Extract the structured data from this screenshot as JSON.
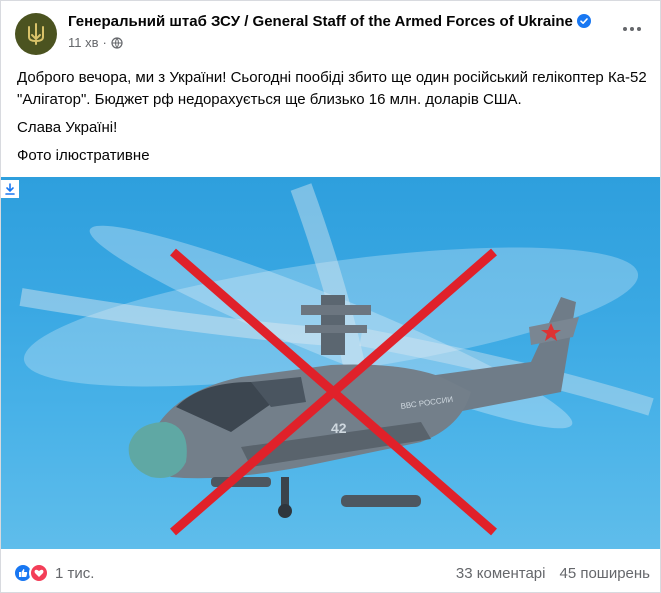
{
  "post": {
    "page_name": "Генеральний штаб ЗСУ / General Staff of the Armed Forces of Ukraine",
    "time": "11 хв",
    "paragraphs": [
      "Доброго вечора, ми з України! Сьогодні пообіді збито ще один російський гелікоптер Ка-52 \"Алігатор\". Бюджет рф недорахується ще близько 16 млн. доларів США.",
      "Слава Україні!",
      "Фото ілюстративне"
    ],
    "image_marking": "42",
    "image_fuselage_text": "ВВС РОССИИ"
  },
  "footer": {
    "reaction_count": "1 тис.",
    "comments": "33 коментарі",
    "shares": "45 поширень"
  },
  "colors": {
    "verified": "#1877f2",
    "like": "#1877f2",
    "love": "#f33e58",
    "cross": "#e0212a",
    "avatar_bg": "#4b5320"
  },
  "icons": [
    "trident-icon",
    "verified-badge-icon",
    "globe-icon",
    "more-options-icon",
    "download-icon",
    "like-reaction-icon",
    "love-reaction-icon"
  ]
}
